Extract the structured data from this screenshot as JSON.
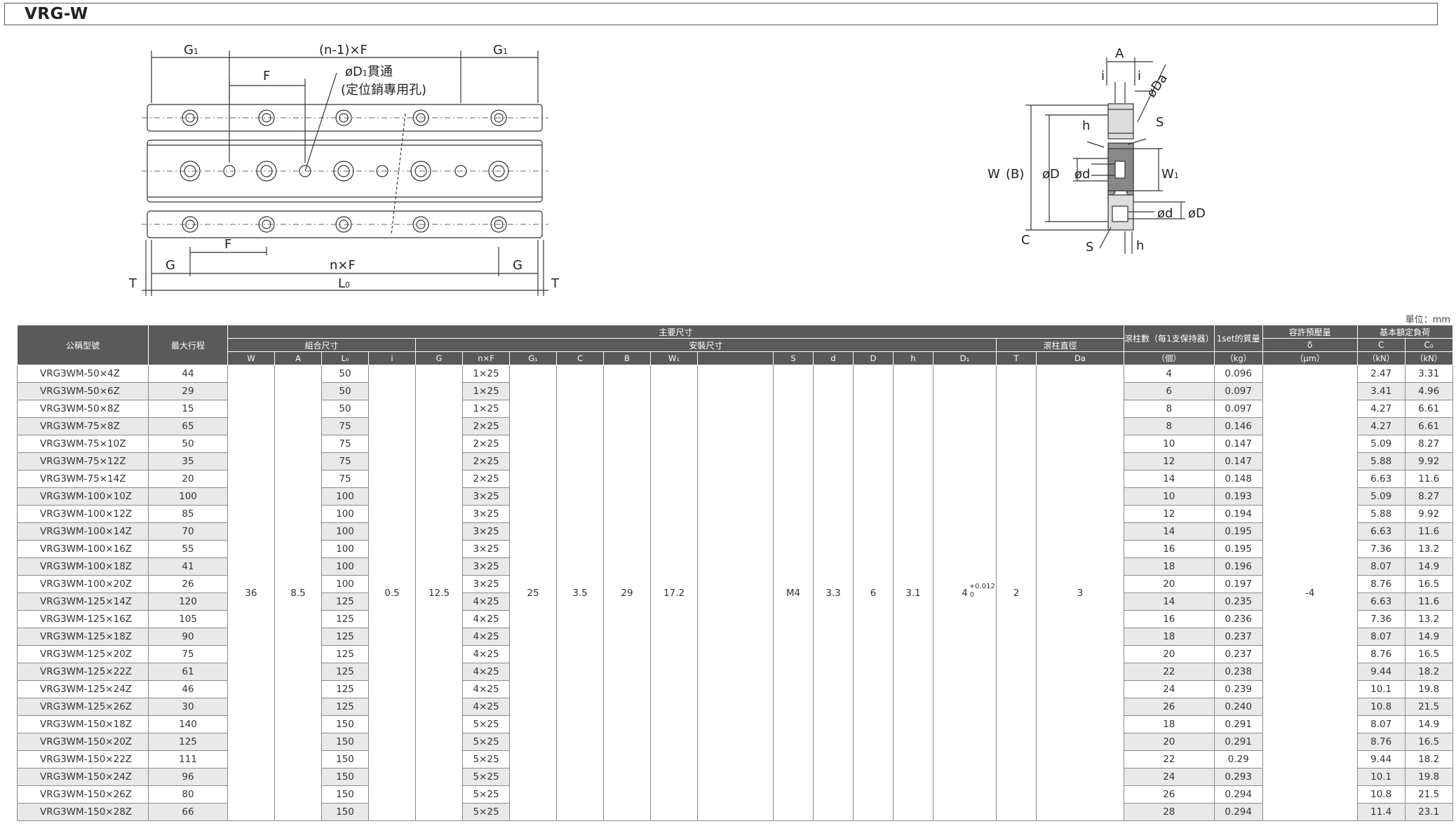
{
  "title": "VRG-W",
  "unit_note": "單位：mm",
  "left_drawing": {
    "g1_left": "G",
    "g1_right": "G",
    "n1f": "(n-1)×F",
    "f_top": "F",
    "d1_label": "øD",
    "d1_suffix": "貫通",
    "d1_note": "(定位銷專用孔)",
    "f_bottom": "F",
    "g_left": "G",
    "nf": "n×F",
    "g_right": "G",
    "t_left": "T",
    "l0": "L",
    "t_right": "T",
    "sub1": "1",
    "sub0": "0"
  },
  "right_drawing": {
    "a": "A",
    "i_left": "i",
    "i_right": "i",
    "da": "øDa",
    "h_top": "h",
    "s_top": "S",
    "w": "W",
    "b": "(B)",
    "d_outer": "øD",
    "d_inner": "ød",
    "w1": "W",
    "w1_sub": "1",
    "d_small": "ød",
    "d_small_outer": "øD",
    "c": "C",
    "s_bottom": "S",
    "h_bottom": "h"
  },
  "table": {
    "head": {
      "model": "公稱型號",
      "stroke": "最大行程",
      "main_dims": "主要尺寸",
      "combo_dims": "組合尺寸",
      "mount_dims": "安裝尺寸",
      "roller_dia": "滾柱直徑",
      "roller_count": "滾柱數（每1支保持器）",
      "roller_count_unit": "（個）",
      "mass": "1set的質量",
      "mass_unit": "（kg）",
      "preload": "容許預壓量",
      "preload_sym": "δ",
      "preload_unit": "（μm）",
      "load_rating": "基本額定負荷",
      "c": "C",
      "c_unit": "（kN）",
      "c0": "C₀",
      "c0_unit": "（kN）",
      "w": "W",
      "a": "A",
      "l0": "L₀",
      "i": "i",
      "g": "G",
      "nf": "n×F",
      "g1": "G₁",
      "cc": "C",
      "b": "B",
      "w1": "W₁",
      "s": "S",
      "d": "d",
      "dd": "D",
      "h": "h",
      "d1": "D₁",
      "t": "T",
      "da": "Da"
    },
    "common": {
      "w": "36",
      "a": "8.5",
      "i": "0.5",
      "g": "12.5",
      "g1": "25",
      "c": "3.5",
      "b": "29",
      "w1": "17.2",
      "s": "M4",
      "d": "3.3",
      "dd": "6",
      "h": "3.1",
      "d1": "4",
      "d1_upper": "+0.012",
      "d1_lower": "0",
      "t": "2",
      "da": "3",
      "preload": "-4"
    },
    "rows": [
      [
        "VRG3WM-50×4Z",
        "44",
        "50",
        "1×25",
        "4",
        "0.096",
        "2.47",
        "3.31"
      ],
      [
        "VRG3WM-50×6Z",
        "29",
        "50",
        "1×25",
        "6",
        "0.097",
        "3.41",
        "4.96"
      ],
      [
        "VRG3WM-50×8Z",
        "15",
        "50",
        "1×25",
        "8",
        "0.097",
        "4.27",
        "6.61"
      ],
      [
        "VRG3WM-75×8Z",
        "65",
        "75",
        "2×25",
        "8",
        "0.146",
        "4.27",
        "6.61"
      ],
      [
        "VRG3WM-75×10Z",
        "50",
        "75",
        "2×25",
        "10",
        "0.147",
        "5.09",
        "8.27"
      ],
      [
        "VRG3WM-75×12Z",
        "35",
        "75",
        "2×25",
        "12",
        "0.147",
        "5.88",
        "9.92"
      ],
      [
        "VRG3WM-75×14Z",
        "20",
        "75",
        "2×25",
        "14",
        "0.148",
        "6.63",
        "11.6"
      ],
      [
        "VRG3WM-100×10Z",
        "100",
        "100",
        "3×25",
        "10",
        "0.193",
        "5.09",
        "8.27"
      ],
      [
        "VRG3WM-100×12Z",
        "85",
        "100",
        "3×25",
        "12",
        "0.194",
        "5.88",
        "9.92"
      ],
      [
        "VRG3WM-100×14Z",
        "70",
        "100",
        "3×25",
        "14",
        "0.195",
        "6.63",
        "11.6"
      ],
      [
        "VRG3WM-100×16Z",
        "55",
        "100",
        "3×25",
        "16",
        "0.195",
        "7.36",
        "13.2"
      ],
      [
        "VRG3WM-100×18Z",
        "41",
        "100",
        "3×25",
        "18",
        "0.196",
        "8.07",
        "14.9"
      ],
      [
        "VRG3WM-100×20Z",
        "26",
        "100",
        "3×25",
        "20",
        "0.197",
        "8.76",
        "16.5"
      ],
      [
        "VRG3WM-125×14Z",
        "120",
        "125",
        "4×25",
        "14",
        "0.235",
        "6.63",
        "11.6"
      ],
      [
        "VRG3WM-125×16Z",
        "105",
        "125",
        "4×25",
        "16",
        "0.236",
        "7.36",
        "13.2"
      ],
      [
        "VRG3WM-125×18Z",
        "90",
        "125",
        "4×25",
        "18",
        "0.237",
        "8.07",
        "14.9"
      ],
      [
        "VRG3WM-125×20Z",
        "75",
        "125",
        "4×25",
        "20",
        "0.237",
        "8.76",
        "16.5"
      ],
      [
        "VRG3WM-125×22Z",
        "61",
        "125",
        "4×25",
        "22",
        "0.238",
        "9.44",
        "18.2"
      ],
      [
        "VRG3WM-125×24Z",
        "46",
        "125",
        "4×25",
        "24",
        "0.239",
        "10.1",
        "19.8"
      ],
      [
        "VRG3WM-125×26Z",
        "30",
        "125",
        "4×25",
        "26",
        "0.240",
        "10.8",
        "21.5"
      ],
      [
        "VRG3WM-150×18Z",
        "140",
        "150",
        "5×25",
        "18",
        "0.291",
        "8.07",
        "14.9"
      ],
      [
        "VRG3WM-150×20Z",
        "125",
        "150",
        "5×25",
        "20",
        "0.291",
        "8.76",
        "16.5"
      ],
      [
        "VRG3WM-150×22Z",
        "111",
        "150",
        "5×25",
        "22",
        "0.29",
        "9.44",
        "18.2"
      ],
      [
        "VRG3WM-150×24Z",
        "96",
        "150",
        "5×25",
        "24",
        "0.293",
        "10.1",
        "19.8"
      ],
      [
        "VRG3WM-150×26Z",
        "80",
        "150",
        "5×25",
        "26",
        "0.294",
        "10.8",
        "21.5"
      ],
      [
        "VRG3WM-150×28Z",
        "66",
        "150",
        "5×25",
        "28",
        "0.294",
        "11.4",
        "23.1"
      ]
    ]
  }
}
